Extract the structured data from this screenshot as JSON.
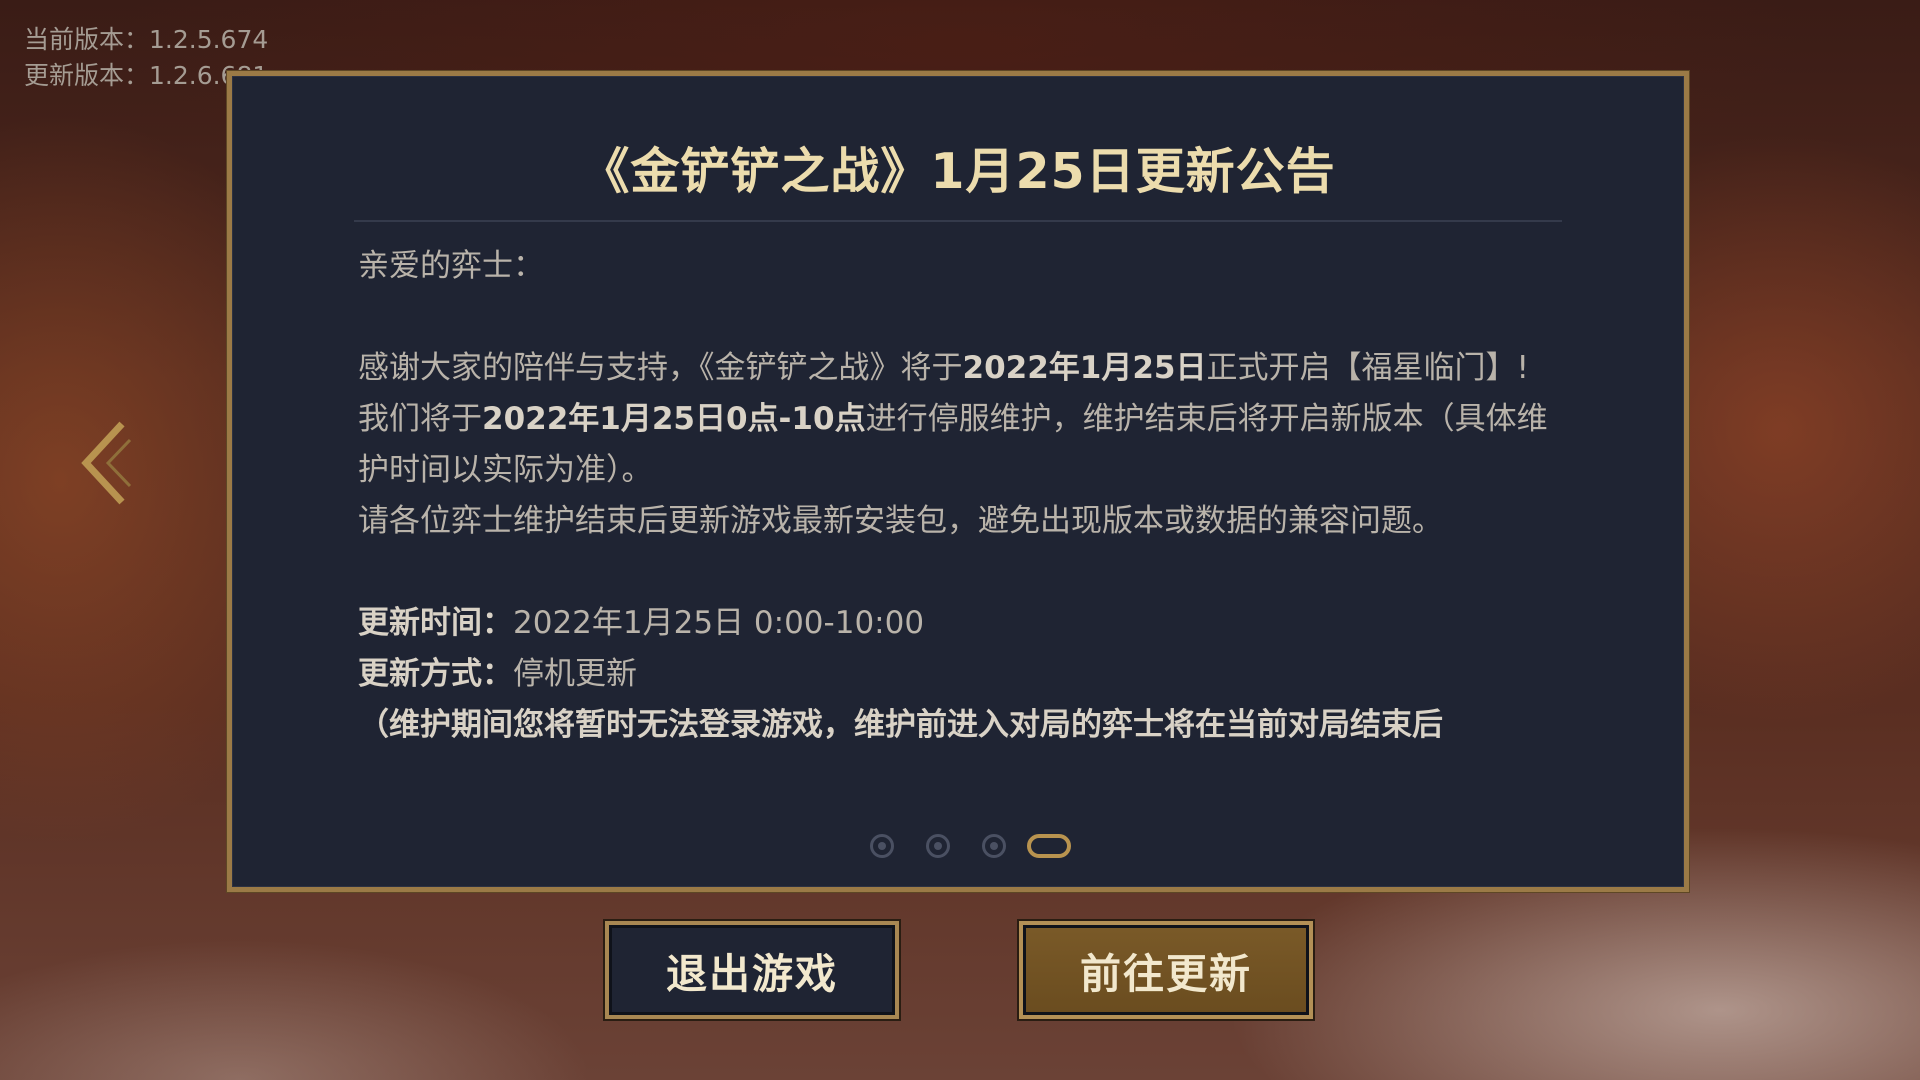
{
  "versions": {
    "current": "当前版本：1.2.5.674",
    "update": "更新版本：1.2.6.681"
  },
  "icons": {
    "prev_arrow": "chevron-left-icon"
  },
  "dialog": {
    "title": "《金铲铲之战》1月25日更新公告",
    "greeting": "亲爱的弈士：",
    "para1_a": "感谢大家的陪伴与支持，《金铲铲之战》将于",
    "para1_b": "2022年1月25日",
    "para1_c": "正式开启【福星临门】!",
    "para2_a": "我们将于",
    "para2_b": "2022年1月25日0点-10点",
    "para2_c": "进行停服维护，维护结束后将开启新版本（具体维护时间以实际为准）。",
    "para3": "请各位弈士维护结束后更新游戏最新安装包，避免出现版本或数据的兼容问题。",
    "time_label": "更新时间：",
    "time_value": "2022年1月25日 0:00-10:00",
    "method_label": "更新方式：",
    "method_value": "停机更新",
    "note": "（维护期间您将暂时无法登录游戏，维护前进入对局的弈士将在当前对局结束后"
  },
  "pagination": {
    "total": 4,
    "active_index": 4
  },
  "buttons": {
    "exit": "退出游戏",
    "update": "前往更新"
  },
  "colors": {
    "gold": "#b8934f",
    "title": "#ecdcad",
    "panel": "#1f2433"
  }
}
